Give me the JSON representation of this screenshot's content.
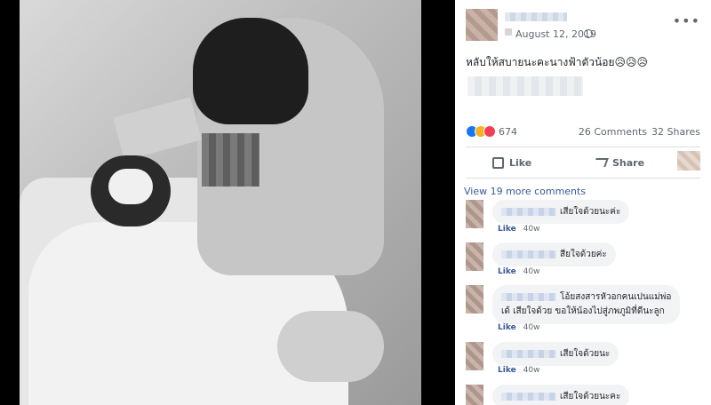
{
  "post": {
    "date": "August 12, 2019",
    "text": "หลับให้สบายนะคะนางฟ้าตัวน้อย😥😥😥",
    "more_menu": "•••",
    "reaction_count": "674",
    "comments_count": "26 Comments",
    "shares_count": "32 Shares",
    "reactions": [
      "like",
      "sad",
      "love"
    ]
  },
  "actions": {
    "like_label": "Like",
    "share_label": "Share"
  },
  "comments": {
    "view_more": "View 19 more comments",
    "items": [
      {
        "text": "เสียใจด้วยนะค่ะ",
        "like": "Like",
        "age": "40w"
      },
      {
        "text": "สียใจด้วยค่ะ",
        "like": "Like",
        "age": "40w"
      },
      {
        "text": "โอ้ยสงสารหัวอกคนเปนแม่พ่อ",
        "text2": "เด้ เสียใจด้วย ขอให้น้องไปสู่ภพภูมิที่ดีนะลูก",
        "like": "Like",
        "age": "40w"
      },
      {
        "text": "เสียใจด้วยนะ",
        "like": "Like",
        "age": "40w"
      },
      {
        "text": "เสียใจด้วยนะคะ"
      }
    ]
  },
  "colors": {
    "link": "#385898",
    "like_reaction": "#1877f2",
    "sad_reaction": "#f7b125",
    "love_reaction": "#f33e58"
  }
}
